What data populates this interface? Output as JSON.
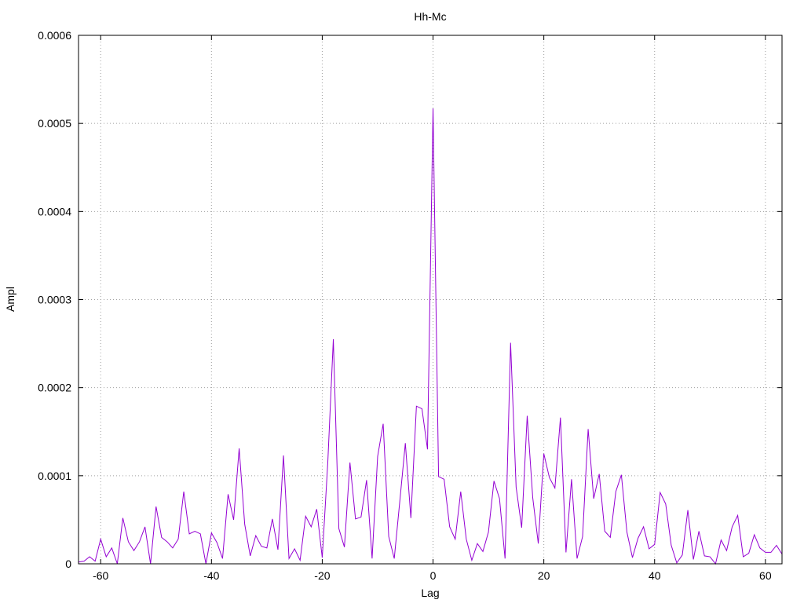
{
  "chart_data": {
    "type": "line",
    "title": "Hh-Mc",
    "xlabel": "Lag",
    "ylabel": "Ampl",
    "xlim": [
      -64,
      63
    ],
    "ylim": [
      0,
      0.0006
    ],
    "grid": true,
    "legend": "none",
    "x_ticks": [
      -60,
      -40,
      -20,
      0,
      20,
      40,
      60
    ],
    "x_tick_labels": [
      "-60",
      "-40",
      "-20",
      "0",
      "20",
      "40",
      "60"
    ],
    "y_ticks": [
      0,
      0.0001,
      0.0002,
      0.0003,
      0.0004,
      0.0005,
      0.0006
    ],
    "y_tick_labels": [
      "0",
      "0.0001",
      "0.0002",
      "0.0003",
      "0.0004",
      "0.0005",
      "0.0006"
    ],
    "colors": {
      "series": "#9400d3",
      "grid": "#a0a0a0",
      "frame": "#000000"
    },
    "series": [
      {
        "x": [
          -64,
          -63,
          -62,
          -61,
          -60,
          -59,
          -58,
          -57,
          -56,
          -55,
          -54,
          -53,
          -52,
          -51,
          -50,
          -49,
          -48,
          -47,
          -46,
          -45,
          -44,
          -43,
          -42,
          -41,
          -40,
          -39,
          -38,
          -37,
          -36,
          -35,
          -34,
          -33,
          -32,
          -31,
          -30,
          -29,
          -28,
          -27,
          -26,
          -25,
          -24,
          -23,
          -22,
          -21,
          -20,
          -19,
          -18,
          -17,
          -16,
          -15,
          -14,
          -13,
          -12,
          -11,
          -10,
          -9,
          -8,
          -7,
          -6,
          -5,
          -4,
          -3,
          -2,
          -1,
          0,
          1,
          2,
          3,
          4,
          5,
          6,
          7,
          8,
          9,
          10,
          11,
          12,
          13,
          14,
          15,
          16,
          17,
          18,
          19,
          20,
          21,
          22,
          23,
          24,
          25,
          26,
          27,
          28,
          29,
          30,
          31,
          32,
          33,
          34,
          35,
          36,
          37,
          38,
          39,
          40,
          41,
          42,
          43,
          44,
          45,
          46,
          47,
          48,
          49,
          50,
          51,
          52,
          53,
          54,
          55,
          56,
          57,
          58,
          59,
          60,
          61,
          62,
          63
        ],
        "values": [
          2e-06,
          3e-06,
          8e-06,
          3e-06,
          2.8e-05,
          8e-06,
          1.8e-05,
          0.0,
          5.2e-05,
          2.5e-05,
          1.5e-05,
          2.5e-05,
          4.2e-05,
          0.0,
          6.5e-05,
          3e-05,
          2.5e-05,
          1.8e-05,
          2.8e-05,
          8.2e-05,
          3.4e-05,
          3.7e-05,
          3.4e-05,
          0.0,
          3.5e-05,
          2.4e-05,
          6e-06,
          7.9e-05,
          5e-05,
          0.000131,
          4.5e-05,
          9e-06,
          3.2e-05,
          2e-05,
          1.8e-05,
          5.1e-05,
          1.6e-05,
          0.000123,
          6e-06,
          1.7e-05,
          4e-06,
          5.4e-05,
          4.2e-05,
          6.2e-05,
          7e-06,
          0.000115,
          0.000255,
          4e-05,
          1.9e-05,
          0.000115,
          5.1e-05,
          5.3e-05,
          9.5e-05,
          6e-06,
          0.000122,
          0.000159,
          3.1e-05,
          6e-06,
          7.1e-05,
          0.000137,
          5.2e-05,
          0.000179,
          0.000176,
          0.00013,
          0.000517,
          9.9e-05,
          9.6e-05,
          4.2e-05,
          2.8e-05,
          8.2e-05,
          2.8e-05,
          4e-06,
          2.3e-05,
          1.4e-05,
          3.6e-05,
          9.4e-05,
          7.4e-05,
          6e-06,
          0.000251,
          8.7e-05,
          4.1e-05,
          0.000168,
          7.5e-05,
          2.3e-05,
          0.000125,
          9.8e-05,
          8.6e-05,
          0.000166,
          1.3e-05,
          9.6e-05,
          6e-06,
          3.1e-05,
          0.000153,
          7.4e-05,
          0.000102,
          3.7e-05,
          3e-05,
          8.2e-05,
          0.000101,
          3.6e-05,
          7e-06,
          2.9e-05,
          4.2e-05,
          1.7e-05,
          2.2e-05,
          8.1e-05,
          6.8e-05,
          2.1e-05,
          1e-06,
          1e-05,
          6.1e-05,
          5e-06,
          3.7e-05,
          9e-06,
          8e-06,
          0.0,
          2.7e-05,
          1.5e-05,
          4.2e-05,
          5.5e-05,
          8e-06,
          1.2e-05,
          3.3e-05,
          1.8e-05,
          1.3e-05,
          1.3e-05,
          2.1e-05,
          1.1e-05
        ]
      }
    ]
  }
}
